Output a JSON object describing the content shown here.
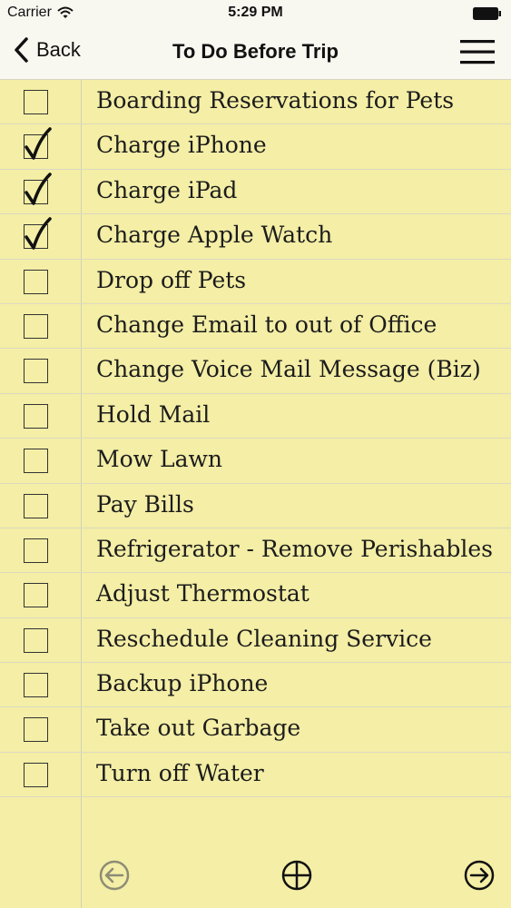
{
  "status": {
    "carrier": "Carrier",
    "time": "5:29 PM"
  },
  "nav": {
    "back_label": "Back",
    "title": "To Do Before Trip"
  },
  "items": [
    {
      "label": "Boarding Reservations for Pets",
      "checked": false
    },
    {
      "label": "Charge iPhone",
      "checked": true
    },
    {
      "label": "Charge iPad",
      "checked": true
    },
    {
      "label": "Charge Apple Watch",
      "checked": true
    },
    {
      "label": "Drop off Pets",
      "checked": false
    },
    {
      "label": "Change Email to out of Office",
      "checked": false
    },
    {
      "label": "Change Voice Mail Message (Biz)",
      "checked": false
    },
    {
      "label": "Hold Mail",
      "checked": false
    },
    {
      "label": "Mow Lawn",
      "checked": false
    },
    {
      "label": "Pay Bills",
      "checked": false
    },
    {
      "label": "Refrigerator - Remove Perishables",
      "checked": false
    },
    {
      "label": "Adjust Thermostat",
      "checked": false
    },
    {
      "label": "Reschedule Cleaning Service",
      "checked": false
    },
    {
      "label": "Backup iPhone",
      "checked": false
    },
    {
      "label": "Take out Garbage",
      "checked": false
    },
    {
      "label": "Turn off Water",
      "checked": false
    }
  ],
  "toolbar": {
    "icons": [
      "arrow-left-circle-icon",
      "plus-circle-icon",
      "arrow-right-circle-icon"
    ]
  },
  "colors": {
    "paper": "#f4eea6",
    "bar": "#f8f7f0",
    "ink": "#1c1c1c"
  }
}
